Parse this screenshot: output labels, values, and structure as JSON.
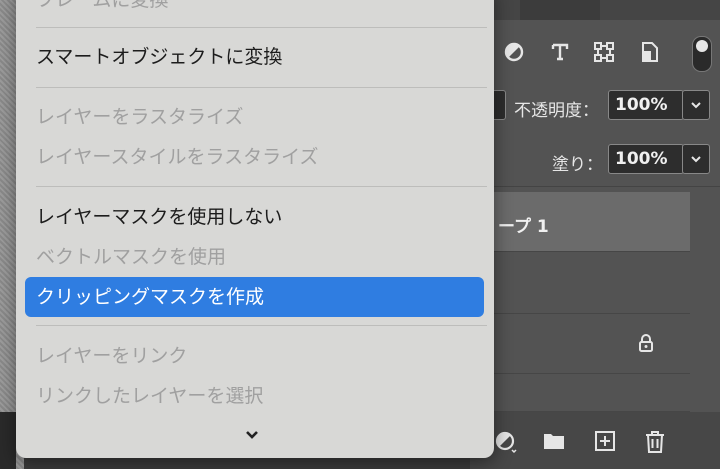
{
  "menu": {
    "items": [
      {
        "label": "フレームに変換",
        "enabled": false
      },
      {
        "label": "スマートオブジェクトに変換",
        "enabled": true
      },
      {
        "label": "レイヤーをラスタライズ",
        "enabled": false
      },
      {
        "label": "レイヤースタイルをラスタライズ",
        "enabled": false
      },
      {
        "label": "レイヤーマスクを使用しない",
        "enabled": true
      },
      {
        "label": "ベクトルマスクを使用",
        "enabled": false
      },
      {
        "label": "クリッピングマスクを作成",
        "enabled": true,
        "highlighted": true
      },
      {
        "label": "レイヤーをリンク",
        "enabled": false
      },
      {
        "label": "リンクしたレイヤーを選択",
        "enabled": false
      }
    ],
    "scroll_icon": "chevron-down-icon",
    "highlight_color": "#2f7de1"
  },
  "layers_panel": {
    "filter_icons": [
      "adjustment-filter-icon",
      "type-filter-icon",
      "shape-filter-icon",
      "smart-object-filter-icon"
    ],
    "opacity": {
      "label": "不透明度：",
      "value": "100%"
    },
    "fill": {
      "label": "塗り：",
      "value": "100%"
    },
    "layers": [
      {
        "name": "ープ 1",
        "selected": true
      },
      {
        "name": "",
        "selected": false
      },
      {
        "name": "",
        "selected": false,
        "locked": true
      },
      {
        "name": "",
        "selected": false
      }
    ],
    "bottom_icons": [
      "adjustment-layer-icon",
      "folder-icon",
      "new-layer-icon",
      "trash-icon"
    ]
  }
}
